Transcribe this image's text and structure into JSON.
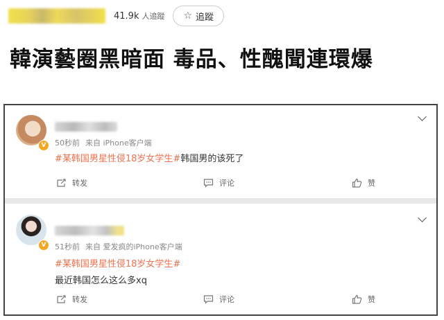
{
  "header": {
    "followers_count": "41.9k",
    "followers_unit": "人追蹤",
    "follow_label": "追蹤"
  },
  "headline": "韓演藝圈黑暗面 毒品、性醜聞連環爆",
  "feed": {
    "posts": [
      {
        "time": "50秒前",
        "source": "来自 iPhone客户端",
        "tag": "#某韩国男星性侵18岁女学生#",
        "text": "韩国男的该死了",
        "actions": {
          "repost": "转发",
          "comment": "评论",
          "like": "赞"
        }
      },
      {
        "time": "51秒前",
        "source": "来自 爱发疯的iPhone客户端",
        "tag": "#某韩国男星性侵18岁女学生#",
        "text": "最近韩国怎么这么多xq",
        "actions": {
          "repost": "转发",
          "comment": "评论",
          "like": "赞"
        }
      }
    ]
  },
  "colors": {
    "tag": "#eb7350",
    "verified_badge": "#f5a623",
    "name_blur": "#eed95a"
  },
  "icons": [
    "star-icon",
    "chevron-down-icon",
    "repost-icon",
    "comment-icon",
    "like-icon",
    "verified-badge-icon"
  ]
}
